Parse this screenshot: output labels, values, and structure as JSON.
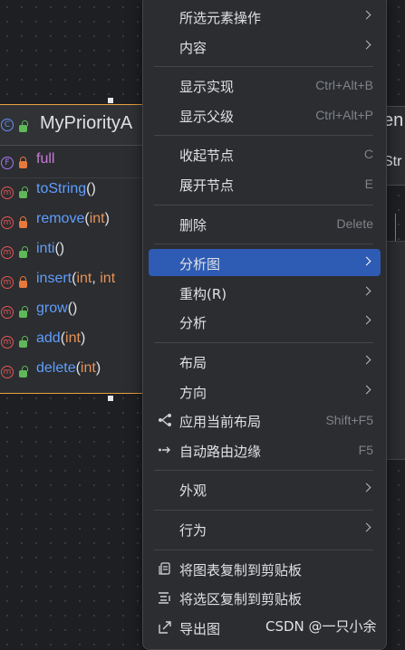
{
  "diagram": {
    "class_name": "MyPriorityA",
    "members": [
      {
        "kind": "field",
        "name": "full",
        "lock": "closed",
        "open": "",
        "params": [],
        "close": ""
      },
      {
        "kind": "method",
        "name": "toString",
        "lock": "open",
        "open": "(",
        "params": [],
        "close": ")"
      },
      {
        "kind": "method",
        "name": "remove",
        "lock": "closed",
        "open": "(",
        "params": [
          "int"
        ],
        "close": ")"
      },
      {
        "kind": "method",
        "name": "inti",
        "lock": "open",
        "open": "(",
        "params": [],
        "close": ")"
      },
      {
        "kind": "method",
        "name": "insert",
        "lock": "closed",
        "open": "(",
        "params": [
          "int",
          "int"
        ],
        "close": ""
      },
      {
        "kind": "method",
        "name": "grow",
        "lock": "open",
        "open": "(",
        "params": [],
        "close": ")"
      },
      {
        "kind": "method",
        "name": "add",
        "lock": "open",
        "open": "(",
        "params": [
          "int"
        ],
        "close": ")"
      },
      {
        "kind": "method",
        "name": "delete",
        "lock": "open",
        "open": "(",
        "params": [
          "int"
        ],
        "close": ")"
      }
    ],
    "badges": {
      "class": "C",
      "field": "F",
      "method": "m"
    },
    "partial_node": {
      "title": "en",
      "sub": "Str"
    }
  },
  "context_menu": {
    "items": [
      {
        "id": "selected-elements-ops",
        "label": "所选元素操作",
        "shortcut": "",
        "submenu": true,
        "icon": ""
      },
      {
        "id": "content",
        "label": "内容",
        "shortcut": "",
        "submenu": true,
        "icon": ""
      },
      {
        "sep": true
      },
      {
        "id": "show-implementations",
        "label": "显示实现",
        "shortcut": "Ctrl+Alt+B",
        "submenu": false,
        "icon": ""
      },
      {
        "id": "show-parents",
        "label": "显示父级",
        "shortcut": "Ctrl+Alt+P",
        "submenu": false,
        "icon": ""
      },
      {
        "sep": true
      },
      {
        "id": "collapse-nodes",
        "label": "收起节点",
        "shortcut": "C",
        "submenu": false,
        "icon": ""
      },
      {
        "id": "expand-nodes",
        "label": "展开节点",
        "shortcut": "E",
        "submenu": false,
        "icon": ""
      },
      {
        "sep": true
      },
      {
        "id": "delete",
        "label": "删除",
        "shortcut": "Delete",
        "submenu": false,
        "icon": ""
      },
      {
        "sep": true
      },
      {
        "id": "analyze-graph",
        "label": "分析图",
        "shortcut": "",
        "submenu": true,
        "icon": "",
        "selected": true
      },
      {
        "id": "refactor",
        "label": "重构(R)",
        "shortcut": "",
        "submenu": true,
        "icon": ""
      },
      {
        "id": "analyze",
        "label": "分析",
        "shortcut": "",
        "submenu": true,
        "icon": ""
      },
      {
        "sep": true
      },
      {
        "id": "layout",
        "label": "布局",
        "shortcut": "",
        "submenu": true,
        "icon": ""
      },
      {
        "id": "orientation",
        "label": "方向",
        "shortcut": "",
        "submenu": true,
        "icon": ""
      },
      {
        "id": "apply-current-layout",
        "label": "应用当前布局",
        "shortcut": "Shift+F5",
        "submenu": false,
        "icon": "apply-layout-icon"
      },
      {
        "id": "auto-route-edges",
        "label": "自动路由边缘",
        "shortcut": "F5",
        "submenu": false,
        "icon": "route-edges-icon"
      },
      {
        "sep": true
      },
      {
        "id": "appearance",
        "label": "外观",
        "shortcut": "",
        "submenu": true,
        "icon": ""
      },
      {
        "sep": true
      },
      {
        "id": "behavior",
        "label": "行为",
        "shortcut": "",
        "submenu": true,
        "icon": ""
      },
      {
        "sep": true
      },
      {
        "id": "copy-diagram",
        "label": "将图表复制到剪贴板",
        "shortcut": "",
        "submenu": false,
        "icon": "copy-diagram-icon"
      },
      {
        "id": "copy-selection",
        "label": "将选区复制到剪贴板",
        "shortcut": "",
        "submenu": false,
        "icon": "copy-selection-icon"
      },
      {
        "id": "export-diagram",
        "label": "导出图",
        "shortcut": "",
        "submenu": false,
        "icon": "export-icon"
      }
    ]
  },
  "watermark": "CSDN @一只小余",
  "colors": {
    "accent_selected": "#2e5bb3",
    "class_border": "#e8a33d",
    "method_name": "#5f9eff",
    "field_name": "#c77dd7",
    "param_type": "#e6935a",
    "shortcut": "#7f8287"
  }
}
